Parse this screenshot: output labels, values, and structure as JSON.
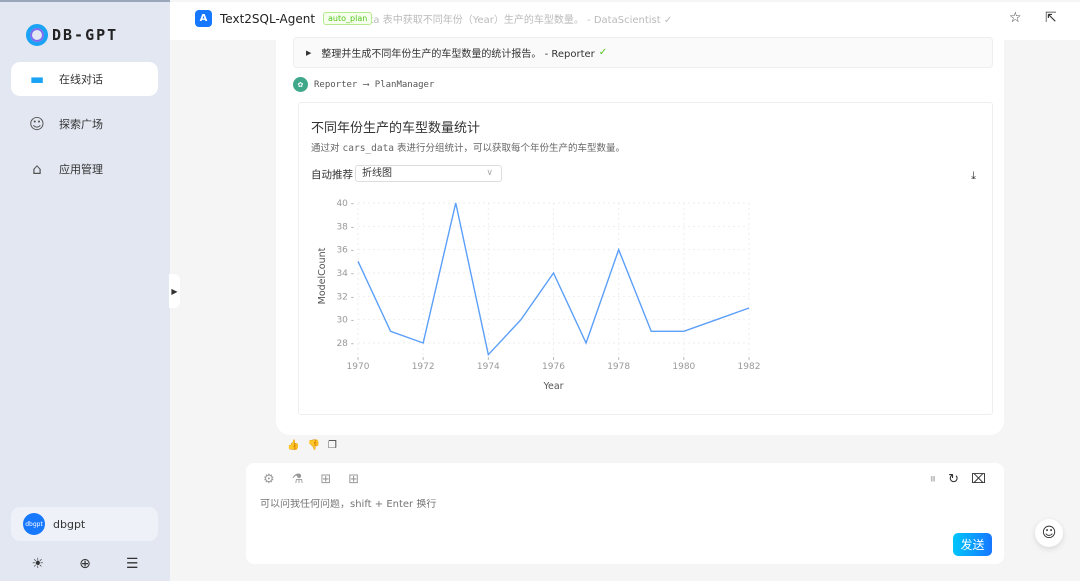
{
  "sidebar": {
    "logo_text": "DB-GPT",
    "items": [
      {
        "label": "在线对话",
        "icon": "chat-icon",
        "active": true
      },
      {
        "label": "探索广场",
        "icon": "explore-icon"
      },
      {
        "label": "应用管理",
        "icon": "robot-icon"
      }
    ],
    "user": {
      "avatar": "dbgpt",
      "name": "dbgpt"
    }
  },
  "header": {
    "agent_name": "Text2SQL-Agent",
    "badge": "auto_plan",
    "faded_step": "data 表中获取不同年份（Year）生产的车型数量。 - DataScientist ✓"
  },
  "plan": {
    "step": "整理并生成不同年份生产的车型数量的统计报告。 - Reporter",
    "status": "✓"
  },
  "route": {
    "from": "Reporter",
    "arrow": "⟶",
    "to": "PlanManager"
  },
  "card": {
    "title": "不同年份生产的车型数量统计",
    "desc_pre": "通过对 ",
    "desc_code": "cars_data",
    "desc_post": " 表进行分组统计，可以获取每个年份生产的车型数量。",
    "auto_label": "自动推荐",
    "chart_type": "折线图"
  },
  "chart_data": {
    "type": "line",
    "xlabel": "Year",
    "ylabel": "ModelCount",
    "x": [
      1970,
      1971,
      1972,
      1973,
      1974,
      1975,
      1976,
      1977,
      1978,
      1979,
      1980,
      1981,
      1982
    ],
    "values": [
      35,
      29,
      28,
      40,
      27,
      30,
      34,
      28,
      36,
      29,
      29,
      30,
      31
    ],
    "xticks": [
      1970,
      1972,
      1974,
      1976,
      1978,
      1980,
      1982
    ],
    "yticks": [
      28,
      30,
      32,
      34,
      36,
      38,
      40
    ],
    "ylim": [
      27,
      40
    ],
    "xlim": [
      1970,
      1982
    ],
    "grid": true,
    "color": "#5b9ff9"
  },
  "input": {
    "placeholder": "可以问我任何问题，shift + Enter 换行",
    "send": "发送"
  }
}
